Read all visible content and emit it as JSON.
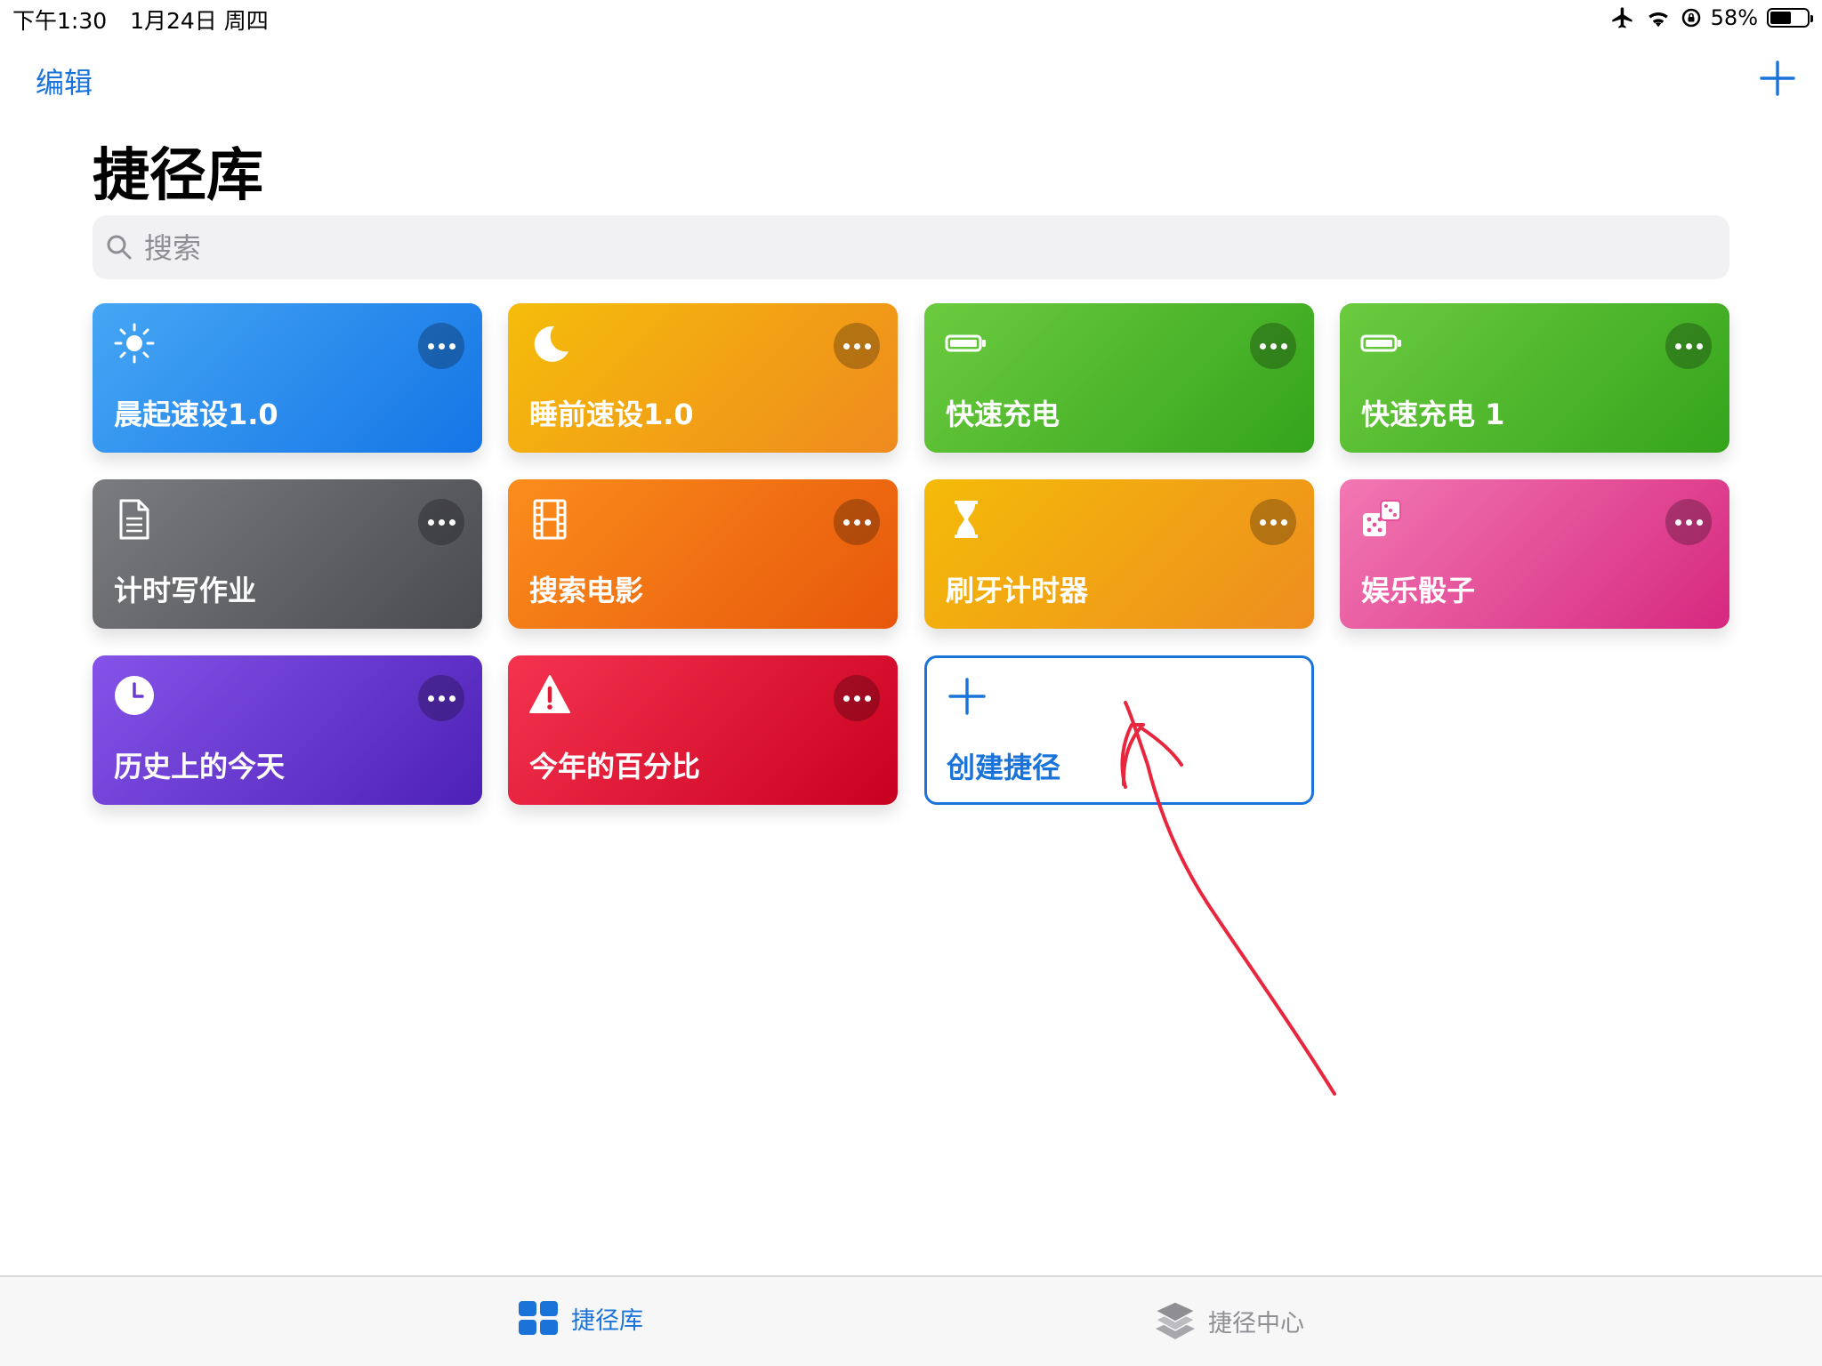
{
  "status_bar": {
    "time": "下午1:30",
    "date": "1月24日 周四",
    "battery_percent": "58%",
    "battery_level": 0.58,
    "icons": [
      "airplane-icon",
      "wifi-icon",
      "orientation-lock-icon",
      "battery-icon"
    ]
  },
  "nav": {
    "edit_label": "编辑",
    "add_icon": "plus-icon"
  },
  "title": "捷径库",
  "search": {
    "placeholder": "搜索",
    "value": ""
  },
  "shortcuts": [
    {
      "label": "晨起速设1.0",
      "icon": "sun-icon",
      "color": "#2a8ef0"
    },
    {
      "label": "睡前速设1.0",
      "icon": "moon-icon",
      "color": "#f2a313"
    },
    {
      "label": "快速充电",
      "icon": "battery-icon",
      "color": "#4cb82c"
    },
    {
      "label": "快速充电 1",
      "icon": "battery-icon",
      "color": "#4cb82c"
    },
    {
      "label": "计时写作业",
      "icon": "document-icon",
      "color": "#626367"
    },
    {
      "label": "搜索电影",
      "icon": "film-icon",
      "color": "#f27317"
    },
    {
      "label": "刷牙计时器",
      "icon": "hourglass-icon",
      "color": "#f1a414"
    },
    {
      "label": "娱乐骰子",
      "icon": "dice-icon",
      "color": "#e4509a"
    },
    {
      "label": "历史上的今天",
      "icon": "clock-icon",
      "color": "#6a3ad0"
    },
    {
      "label": "今年的百分比",
      "icon": "warning-icon",
      "color": "#e21a38"
    }
  ],
  "create_card": {
    "label": "创建捷径",
    "icon": "plus-icon",
    "color": "#1a73d9"
  },
  "tabs": [
    {
      "label": "捷径库",
      "icon": "grid-icon",
      "active": true
    },
    {
      "label": "捷径中心",
      "icon": "layers-icon",
      "active": false
    }
  ],
  "colors": {
    "accent": "#1a73d9",
    "annotation": "#e8263e"
  }
}
